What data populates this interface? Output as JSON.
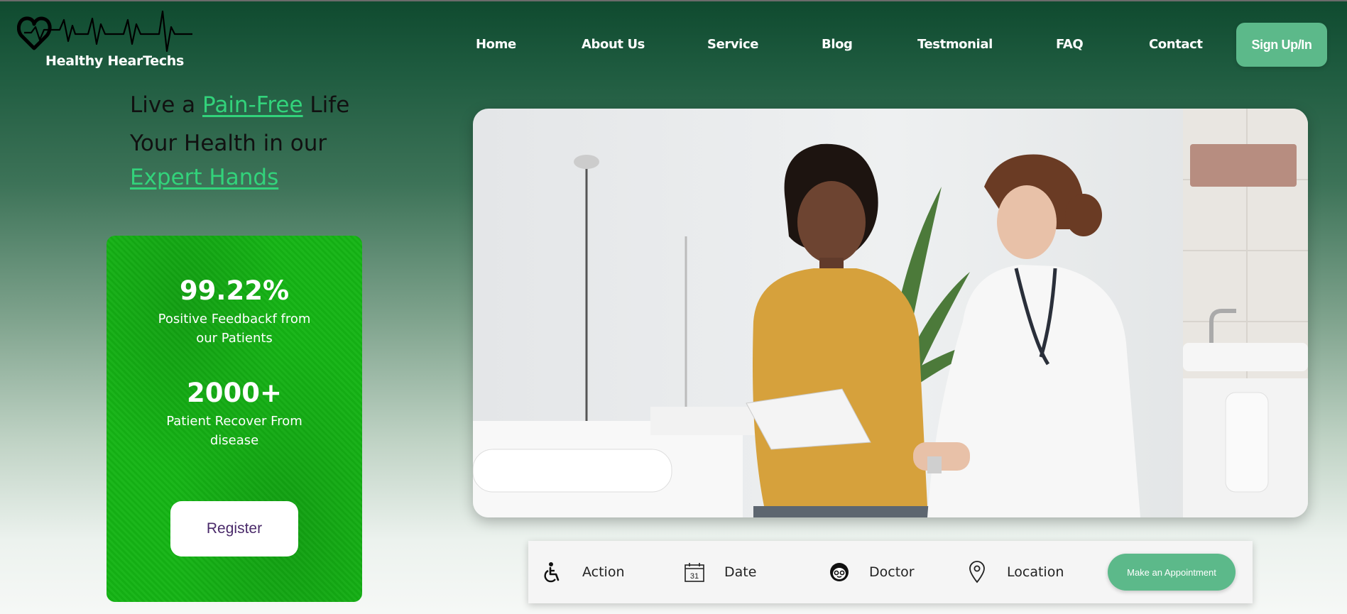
{
  "brand": {
    "name": "Healthy HearTechs",
    "logo_icon": "heartbeat-logo-icon"
  },
  "nav": {
    "items": [
      "Home",
      "About Us",
      "Service",
      "Blog",
      "Testmonial",
      "FAQ",
      "Contact"
    ],
    "signup_label": "Sign Up/In"
  },
  "hero": {
    "line1_prefix": "Live a ",
    "line1_highlight": "Pain-Free",
    "line1_suffix": " Life",
    "line2": "Your Health in our",
    "line3_highlight": "Expert Hands"
  },
  "stats": {
    "items": [
      {
        "value": "99.22%",
        "label": "Positive Feedbackf from our Patients"
      },
      {
        "value": "2000+",
        "label": "Patient Recover From disease"
      }
    ],
    "register_label": "Register"
  },
  "booking": {
    "items": [
      {
        "icon": "wheelchair-icon",
        "label": "Action"
      },
      {
        "icon": "calendar-icon",
        "label": "Date",
        "calendar_day": "31"
      },
      {
        "icon": "doctor-icon",
        "label": "Doctor"
      },
      {
        "icon": "location-pin-icon",
        "label": "Location"
      }
    ],
    "appointment_label": "Make an Appointment"
  },
  "colors": {
    "accent": "#5cb98a",
    "highlight": "#32d37b",
    "card": "#15b515"
  }
}
